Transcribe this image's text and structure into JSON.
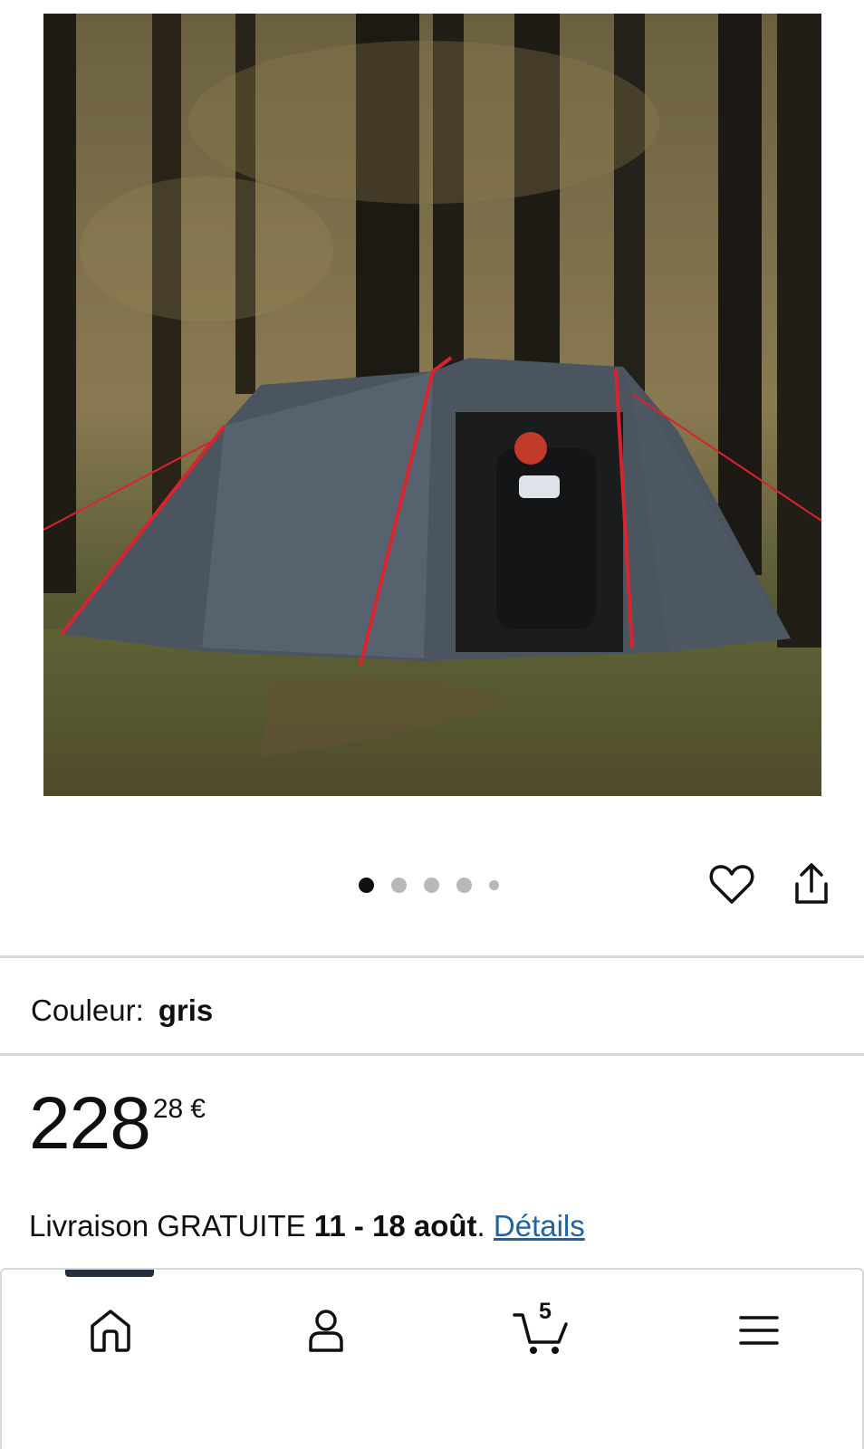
{
  "product": {
    "image_alt": "Tente grise avec moto sous les arbres",
    "gallery": {
      "count": 5,
      "active_index": 0
    }
  },
  "actions": {
    "wishlist_icon": "heart-icon",
    "share_icon": "share-icon"
  },
  "variation": {
    "label": "Couleur:",
    "value": "gris"
  },
  "price": {
    "whole": "228",
    "fraction": "28",
    "currency": "€"
  },
  "delivery": {
    "prefix": "Livraison GRATUITE ",
    "dates": "11 - 18 août",
    "suffix": ". ",
    "details_link": "Détails"
  },
  "bottom_nav": {
    "items": [
      {
        "icon": "home-icon",
        "active": true
      },
      {
        "icon": "account-icon"
      },
      {
        "icon": "cart-icon",
        "badge": "5"
      },
      {
        "icon": "menu-icon"
      }
    ]
  },
  "colors": {
    "link": "#2162a1",
    "text": "#0f1111",
    "divider": "#d5d9d9",
    "dot_inactive": "#b8b8b8"
  }
}
